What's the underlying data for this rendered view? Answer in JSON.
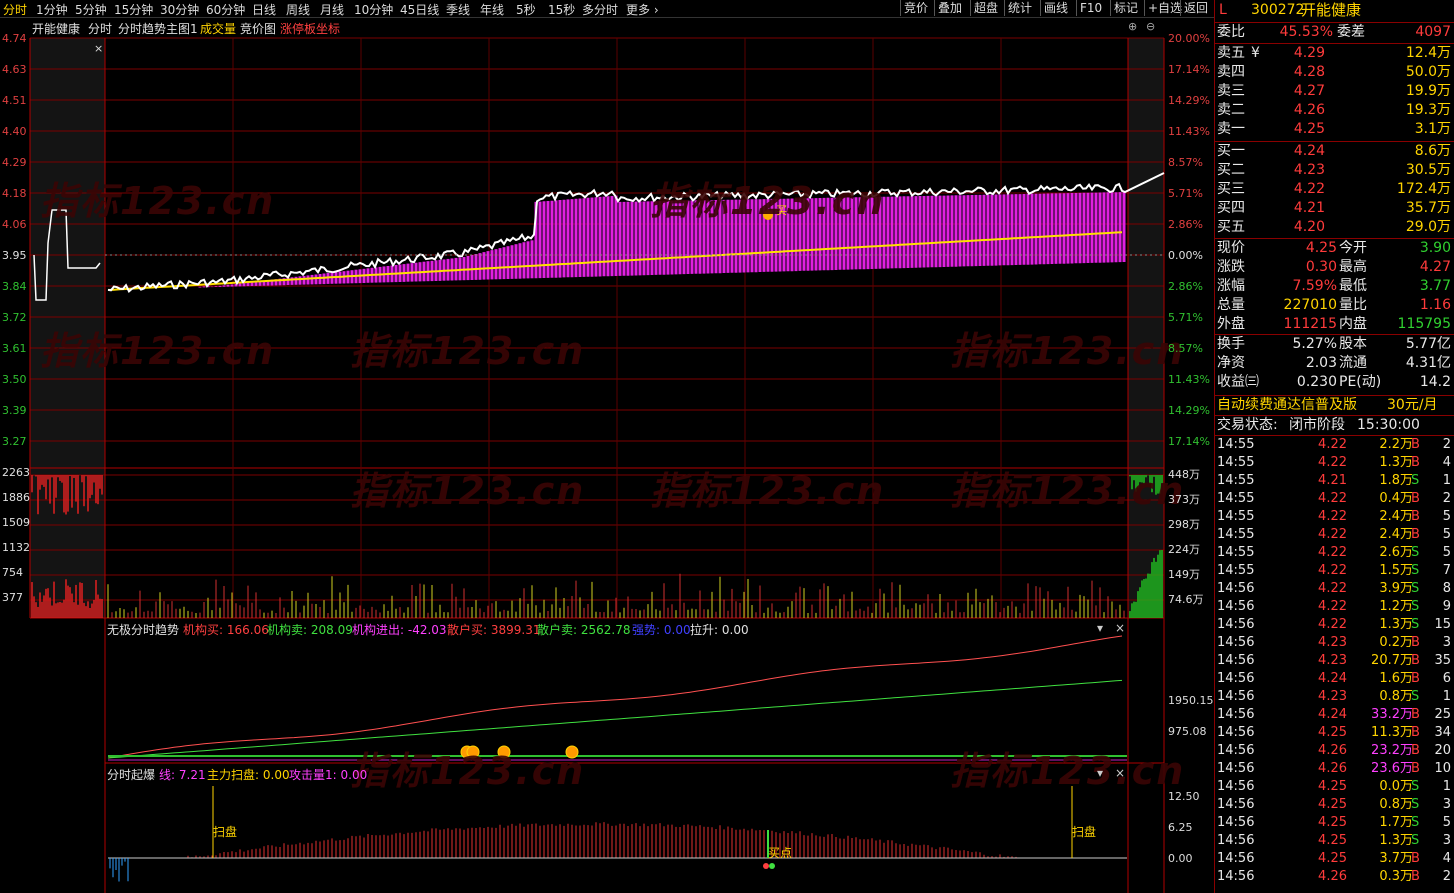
{
  "toolbar": {
    "tabs": [
      "分时",
      "1分钟",
      "5分钟",
      "15分钟",
      "30分钟",
      "60分钟",
      "日线",
      "周线",
      "月线",
      "10分钟",
      "45日线",
      "季线",
      "年线",
      "5秒",
      "15秒",
      "多分时",
      "更多"
    ],
    "more_icon": "chevron-right-icon",
    "right_buttons": [
      "竞价",
      "叠加",
      "超盘",
      "统计",
      "画线",
      "F10",
      "标记",
      "+自选",
      "返回"
    ]
  },
  "chart_header": {
    "stock_name": "开能健康",
    "items": [
      "分时",
      "分时趋势主图1",
      "成交量",
      "竞价图",
      "涨停板坐标"
    ]
  },
  "watermark": "指标123.cn",
  "price_axis": {
    "left": [
      "4.74",
      "4.63",
      "4.51",
      "4.40",
      "4.29",
      "4.18",
      "4.06",
      "3.95",
      "3.84",
      "3.72",
      "3.61",
      "3.50",
      "3.39",
      "3.27"
    ],
    "right": [
      "20.00%",
      "17.14%",
      "14.29%",
      "11.43%",
      "8.57%",
      "5.71%",
      "2.86%",
      "0.00%",
      "2.86%",
      "5.71%",
      "8.57%",
      "11.43%",
      "14.29%",
      "17.14%"
    ]
  },
  "volume_axis": {
    "left": [
      "2263",
      "1886",
      "1509",
      "1132",
      "754",
      "377"
    ],
    "right": [
      "448万",
      "373万",
      "298万",
      "224万",
      "149万",
      "74.6万"
    ]
  },
  "annotations": {
    "buy_label": "买"
  },
  "indicator1": {
    "name": "无极分时趋势",
    "fields": [
      {
        "label": "机构买:",
        "value": "166.06"
      },
      {
        "label": "机构卖:",
        "value": "208.09"
      },
      {
        "label": "机构进出:",
        "value": "-42.03"
      },
      {
        "label": "散户买:",
        "value": "3899.31"
      },
      {
        "label": "散户卖:",
        "value": "2562.78"
      },
      {
        "label": "强势:",
        "value": "0.00"
      },
      {
        "label": "拉升:",
        "value": "0.00"
      }
    ],
    "axis": [
      "1950.15",
      "975.08"
    ]
  },
  "indicator2": {
    "name": "分时起爆",
    "fields": [
      {
        "label": "线:",
        "value": "7.21"
      },
      {
        "label": "主力扫盘:",
        "value": "0.00"
      },
      {
        "label": "攻击量1:",
        "value": "0.00"
      }
    ],
    "axis": [
      "12.50",
      "6.25",
      "0.00"
    ],
    "labels": {
      "sweep": "扫盘",
      "buy_point": "买点"
    }
  },
  "quote": {
    "flag": "L",
    "code": "300272",
    "name": "开能健康",
    "weibi_label": "委比",
    "weibi": "45.53%",
    "weicha_label": "委差",
    "weicha": "4097",
    "asks": [
      {
        "label": "卖五",
        "price": "4.29",
        "vol": "12.4万"
      },
      {
        "label": "卖四",
        "price": "4.28",
        "vol": "50.0万"
      },
      {
        "label": "卖三",
        "price": "4.27",
        "vol": "19.9万"
      },
      {
        "label": "卖二",
        "price": "4.26",
        "vol": "19.3万"
      },
      {
        "label": "卖一",
        "price": "4.25",
        "vol": "3.1万"
      }
    ],
    "yen": "¥",
    "bids": [
      {
        "label": "买一",
        "price": "4.24",
        "vol": "8.6万"
      },
      {
        "label": "买二",
        "price": "4.23",
        "vol": "30.5万"
      },
      {
        "label": "买三",
        "price": "4.22",
        "vol": "172.4万"
      },
      {
        "label": "买四",
        "price": "4.21",
        "vol": "35.7万"
      },
      {
        "label": "买五",
        "price": "4.20",
        "vol": "29.0万"
      }
    ],
    "stats": [
      {
        "l1": "现价",
        "v1": "4.25",
        "c1": "red",
        "l2": "今开",
        "v2": "3.90",
        "c2": "grn"
      },
      {
        "l1": "涨跌",
        "v1": "0.30",
        "c1": "red",
        "l2": "最高",
        "v2": "4.27",
        "c2": "red"
      },
      {
        "l1": "涨幅",
        "v1": "7.59%",
        "c1": "red",
        "l2": "最低",
        "v2": "3.77",
        "c2": "grn"
      },
      {
        "l1": "总量",
        "v1": "227010",
        "c1": "yel",
        "l2": "量比",
        "v2": "1.16",
        "c2": "red"
      },
      {
        "l1": "外盘",
        "v1": "111215",
        "c1": "red",
        "l2": "内盘",
        "v2": "115795",
        "c2": "grn"
      }
    ],
    "stats2": [
      {
        "l1": "换手",
        "v1": "5.27%",
        "l2": "股本",
        "v2": "5.77亿"
      },
      {
        "l1": "净资",
        "v1": "2.03",
        "l2": "流通",
        "v2": "4.31亿"
      },
      {
        "l1": "收益㈢",
        "v1": "0.230",
        "l2": "PE(动)",
        "v2": "14.2"
      }
    ],
    "promo": "自动续费通达信普及版",
    "promo_price": "30元/月",
    "status_label": "交易状态:",
    "status": "闭市阶段",
    "status_time": "15:30:00"
  },
  "ticks": [
    {
      "t": "14:55",
      "p": "4.22",
      "pc": "red",
      "v": "2.2万",
      "vc": "yel",
      "bs": "B",
      "n": "2"
    },
    {
      "t": "14:55",
      "p": "4.22",
      "pc": "red",
      "v": "1.3万",
      "vc": "yel",
      "bs": "B",
      "n": "4"
    },
    {
      "t": "14:55",
      "p": "4.21",
      "pc": "red",
      "v": "1.8万",
      "vc": "yel",
      "bs": "S",
      "n": "1"
    },
    {
      "t": "14:55",
      "p": "4.22",
      "pc": "red",
      "v": "0.4万",
      "vc": "yel",
      "bs": "B",
      "n": "2"
    },
    {
      "t": "14:55",
      "p": "4.22",
      "pc": "red",
      "v": "2.4万",
      "vc": "yel",
      "bs": "B",
      "n": "5"
    },
    {
      "t": "14:55",
      "p": "4.22",
      "pc": "red",
      "v": "2.4万",
      "vc": "yel",
      "bs": "B",
      "n": "5"
    },
    {
      "t": "14:55",
      "p": "4.22",
      "pc": "red",
      "v": "2.6万",
      "vc": "yel",
      "bs": "S",
      "n": "5"
    },
    {
      "t": "14:55",
      "p": "4.22",
      "pc": "red",
      "v": "1.5万",
      "vc": "yel",
      "bs": "S",
      "n": "7"
    },
    {
      "t": "14:56",
      "p": "4.22",
      "pc": "red",
      "v": "3.9万",
      "vc": "yel",
      "bs": "S",
      "n": "8"
    },
    {
      "t": "14:56",
      "p": "4.22",
      "pc": "red",
      "v": "1.2万",
      "vc": "yel",
      "bs": "S",
      "n": "9"
    },
    {
      "t": "14:56",
      "p": "4.22",
      "pc": "red",
      "v": "1.3万",
      "vc": "yel",
      "bs": "S",
      "n": "15"
    },
    {
      "t": "14:56",
      "p": "4.23",
      "pc": "red",
      "v": "0.2万",
      "vc": "yel",
      "bs": "B",
      "n": "3"
    },
    {
      "t": "14:56",
      "p": "4.23",
      "pc": "red",
      "v": "20.7万",
      "vc": "yel",
      "bs": "B",
      "n": "35"
    },
    {
      "t": "14:56",
      "p": "4.24",
      "pc": "red",
      "v": "1.6万",
      "vc": "yel",
      "bs": "B",
      "n": "6"
    },
    {
      "t": "14:56",
      "p": "4.23",
      "pc": "red",
      "v": "0.8万",
      "vc": "yel",
      "bs": "S",
      "n": "1"
    },
    {
      "t": "14:56",
      "p": "4.24",
      "pc": "red",
      "v": "33.2万",
      "vc": "mag",
      "bs": "B",
      "n": "25"
    },
    {
      "t": "14:56",
      "p": "4.25",
      "pc": "red",
      "v": "11.3万",
      "vc": "yel",
      "bs": "B",
      "n": "34"
    },
    {
      "t": "14:56",
      "p": "4.26",
      "pc": "red",
      "v": "23.2万",
      "vc": "mag",
      "bs": "B",
      "n": "20"
    },
    {
      "t": "14:56",
      "p": "4.26",
      "pc": "red",
      "v": "23.6万",
      "vc": "mag",
      "bs": "B",
      "n": "10"
    },
    {
      "t": "14:56",
      "p": "4.25",
      "pc": "red",
      "v": "0.0万",
      "vc": "yel",
      "bs": "S",
      "n": "1"
    },
    {
      "t": "14:56",
      "p": "4.25",
      "pc": "red",
      "v": "0.8万",
      "vc": "yel",
      "bs": "S",
      "n": "3"
    },
    {
      "t": "14:56",
      "p": "4.25",
      "pc": "red",
      "v": "1.7万",
      "vc": "yel",
      "bs": "S",
      "n": "5"
    },
    {
      "t": "14:56",
      "p": "4.25",
      "pc": "red",
      "v": "1.3万",
      "vc": "yel",
      "bs": "S",
      "n": "3"
    },
    {
      "t": "14:56",
      "p": "4.25",
      "pc": "red",
      "v": "3.7万",
      "vc": "yel",
      "bs": "B",
      "n": "4"
    },
    {
      "t": "14:56",
      "p": "4.26",
      "pc": "red",
      "v": "0.3万",
      "vc": "yel",
      "bs": "B",
      "n": "2"
    }
  ]
}
